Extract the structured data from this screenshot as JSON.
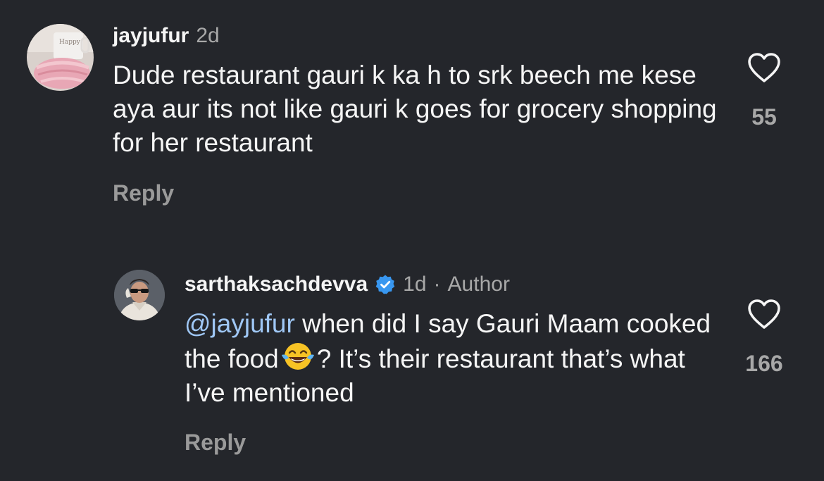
{
  "comments": [
    {
      "username": "jayjufur",
      "time": "2d",
      "text": "Dude restaurant gauri k ka h to srk beech me kese aya aur its not like gauri k goes for grocery shopping for her restaurant",
      "reply_label": "Reply",
      "likes": "55",
      "avatar_icon": "happy-mug-avatar"
    },
    {
      "username": "sarthaksachdevva",
      "verified": true,
      "time": "1d",
      "separator": "·",
      "role": "Author",
      "mention": "@jayjufur",
      "text_part1": "when did I say Gauri Maam cooked the food",
      "emoji": "face-with-tears-of-joy",
      "text_part2": "? It’s their restaurant that’s what I’ve mentioned",
      "reply_label": "Reply",
      "likes": "166",
      "avatar_icon": "man-sunglasses-avatar"
    }
  ],
  "colors": {
    "background": "#24262b",
    "text": "#f5f5f5",
    "muted": "#a8a8a8",
    "mention": "#9fc7f5",
    "verified": "#3897f0"
  }
}
